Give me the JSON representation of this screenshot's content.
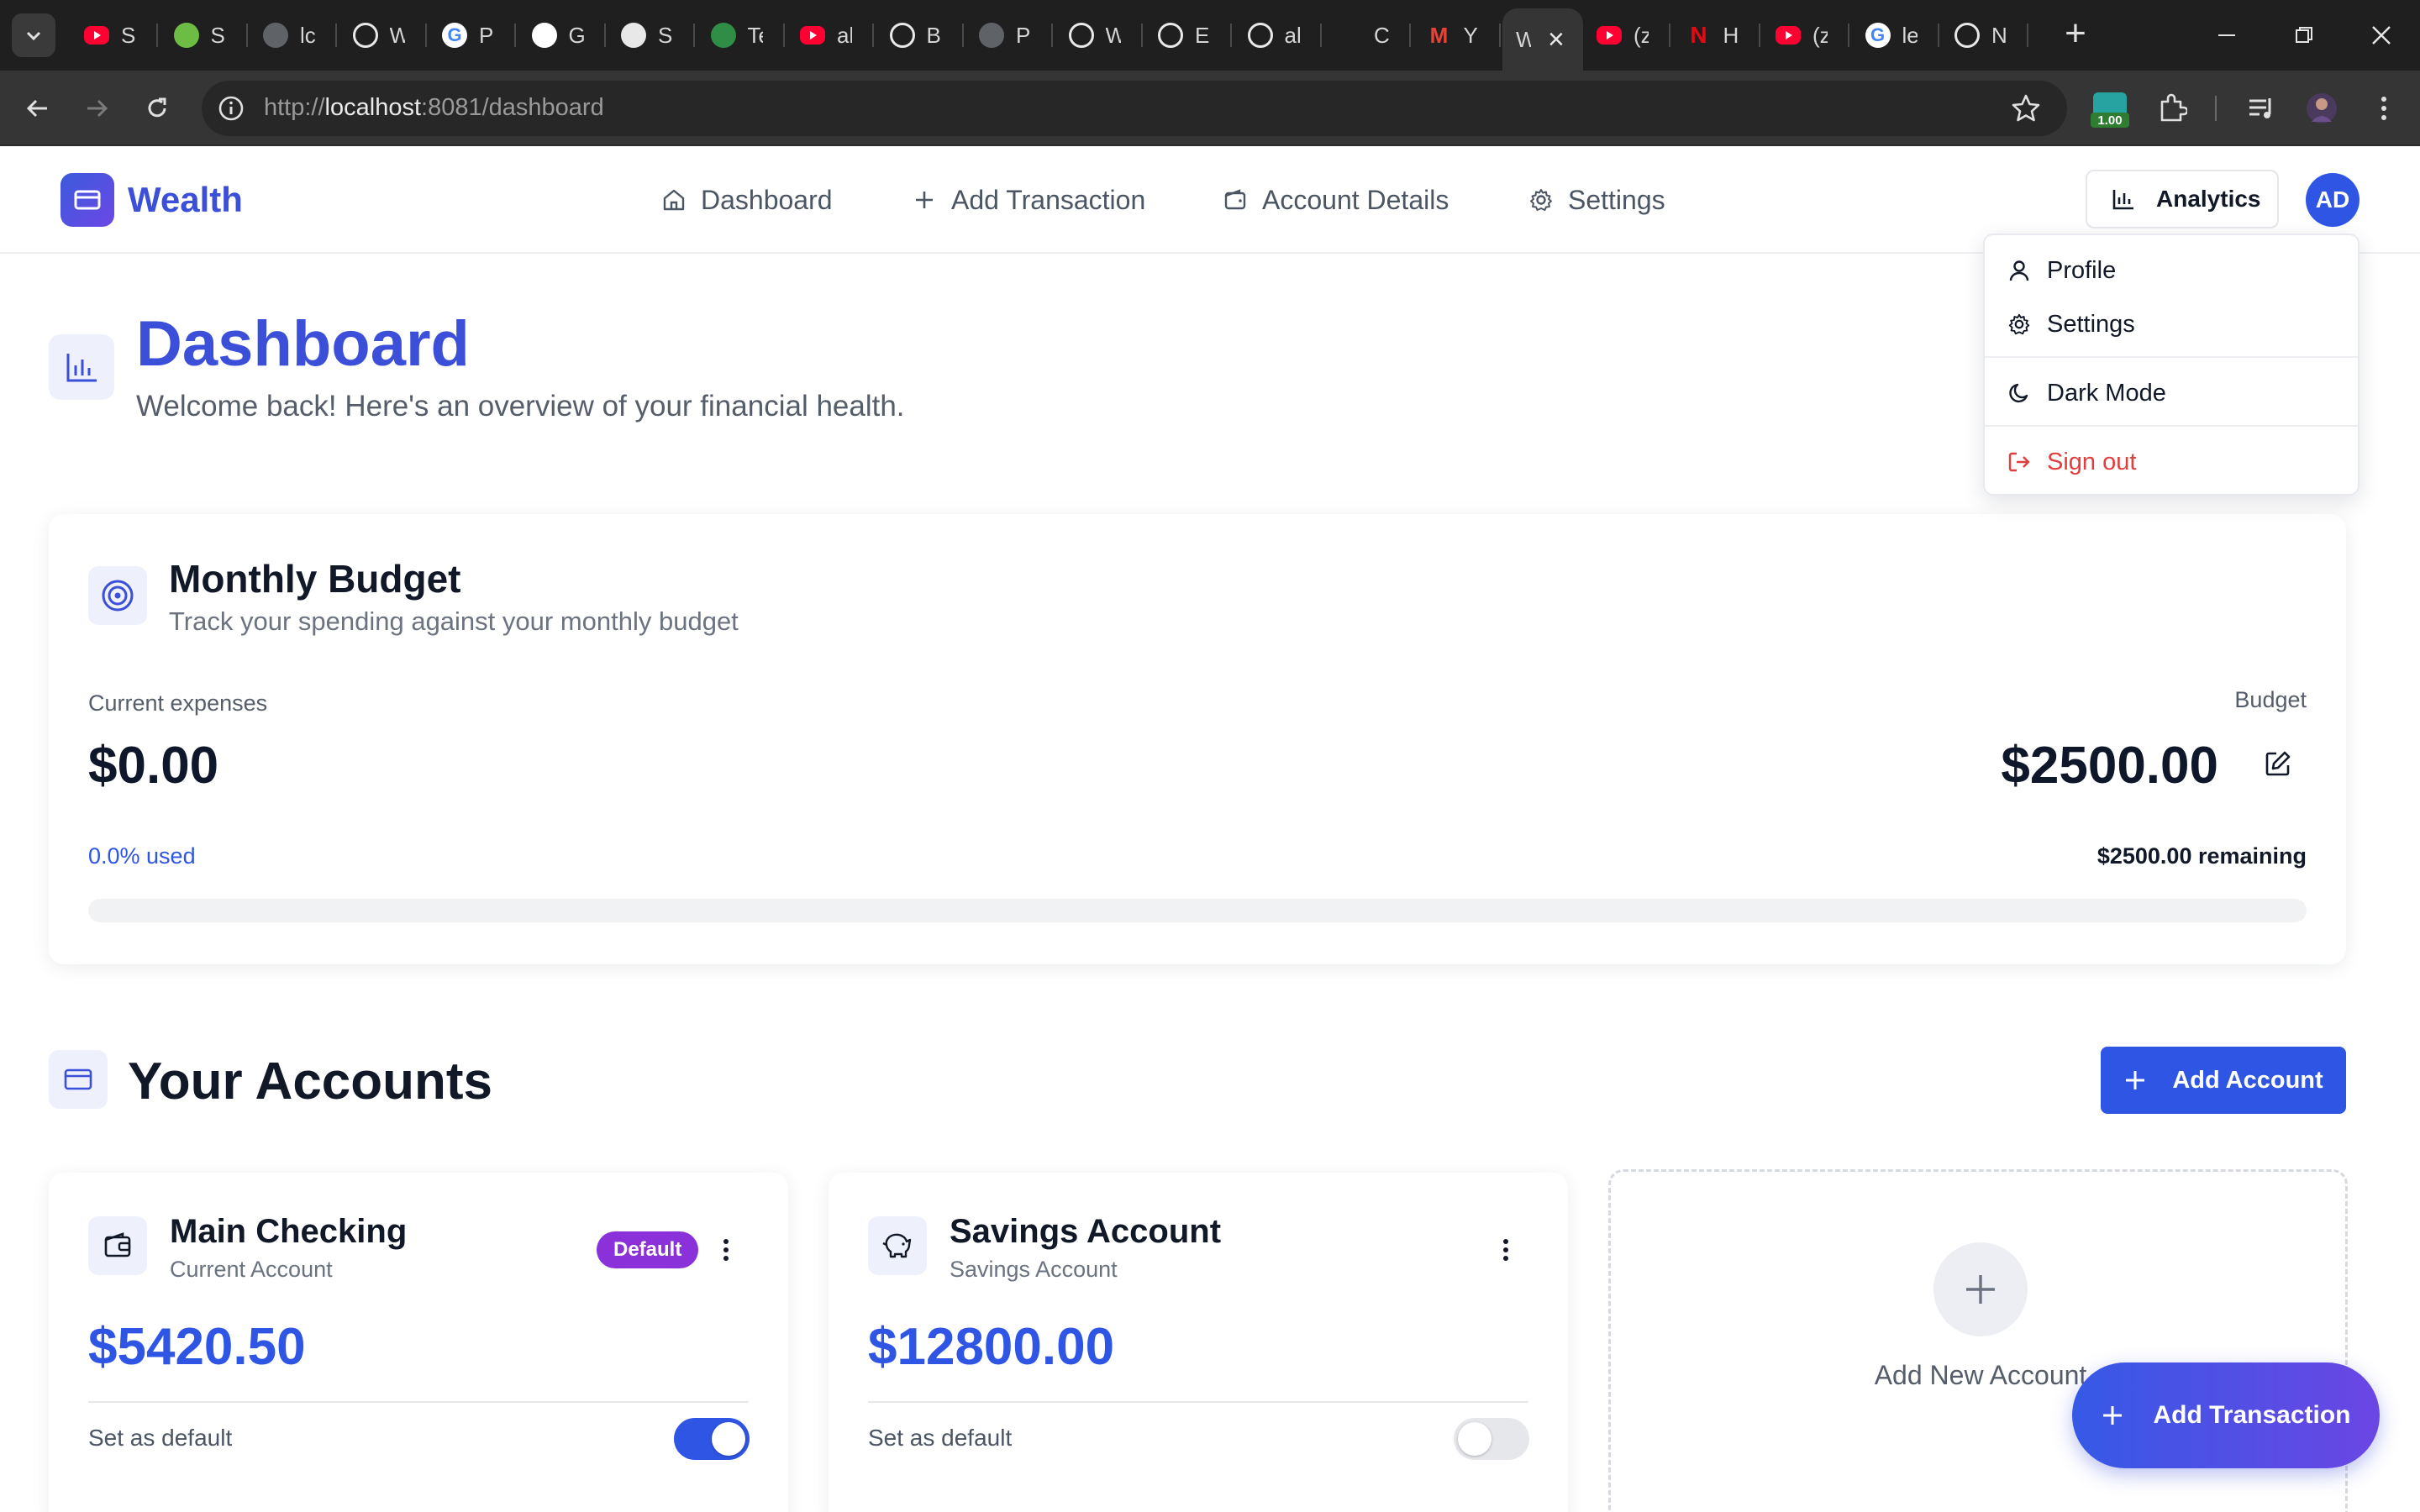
{
  "browser": {
    "tabs": [
      {
        "title": "Si",
        "icon": "youtube-icon",
        "color": "#ff0033"
      },
      {
        "title": "S|",
        "icon": "leaf-icon",
        "color": "#6dbd45"
      },
      {
        "title": "lc",
        "icon": "globe-icon",
        "color": "#5f6368"
      },
      {
        "title": "W",
        "icon": "openai-icon",
        "color": "#1f1f1f"
      },
      {
        "title": "P",
        "icon": "google-icon",
        "color": "#ffffff"
      },
      {
        "title": "G",
        "icon": "tcs-icon",
        "color": "#ffffff"
      },
      {
        "title": "S",
        "icon": "college-icon",
        "color": "#e8e8e8"
      },
      {
        "title": "Te",
        "icon": "gfg-icon",
        "color": "#2f8d46"
      },
      {
        "title": "al",
        "icon": "youtube-icon",
        "color": "#ff0033"
      },
      {
        "title": "B",
        "icon": "stack-icon",
        "color": "#ffffff"
      },
      {
        "title": "P",
        "icon": "globe-icon",
        "color": "#5f6368"
      },
      {
        "title": "W",
        "icon": "openai-icon",
        "color": "#1f1f1f"
      },
      {
        "title": "E",
        "icon": "github-icon",
        "color": "#ffffff"
      },
      {
        "title": "al",
        "icon": "github-icon",
        "color": "#ffffff"
      },
      {
        "title": "C",
        "icon": "link-icon",
        "color": "#1f1f1f"
      },
      {
        "title": "Y",
        "icon": "gmail-icon",
        "color": "#ea4335"
      },
      {
        "title": "W",
        "icon": "page-icon",
        "color": "#353535",
        "active": true
      },
      {
        "title": "(z",
        "icon": "youtube-icon",
        "color": "#ff0033"
      },
      {
        "title": "H",
        "icon": "netflix-icon",
        "color": "#e50914"
      },
      {
        "title": "(z",
        "icon": "youtube-icon",
        "color": "#ff0033"
      },
      {
        "title": "le",
        "icon": "google-icon",
        "color": "#ffffff"
      },
      {
        "title": "N",
        "icon": "chrome-icon",
        "color": "#ffffff"
      }
    ],
    "url_prefix": "http://",
    "url_host": "localhost",
    "url_rest": ":8081/dashboard",
    "extension_badge": "1.00"
  },
  "header": {
    "brand": "Wealth",
    "nav": [
      {
        "label": "Dashboard",
        "icon": "home-icon"
      },
      {
        "label": "Add Transaction",
        "icon": "plus-icon"
      },
      {
        "label": "Account Details",
        "icon": "wallet-icon"
      },
      {
        "label": "Settings",
        "icon": "gear-icon"
      }
    ],
    "analytics_label": "Analytics",
    "avatar_initials": "AD"
  },
  "page": {
    "title": "Dashboard",
    "subtitle": "Welcome back! Here's an overview of your financial health."
  },
  "budget": {
    "title": "Monthly Budget",
    "subtitle": "Track your spending against your monthly budget",
    "expenses_label": "Current expenses",
    "expenses_value": "$0.00",
    "budget_label": "Budget",
    "budget_value": "$2500.00",
    "used_text": "0.0% used",
    "remaining_text": "$2500.00 remaining",
    "used_fraction": 0.0
  },
  "accounts": {
    "title": "Your Accounts",
    "add_button": "Add Account",
    "items": [
      {
        "name": "Main Checking",
        "type": "Current Account",
        "balance": "$5420.50",
        "badge": "Default",
        "default_label": "Set as default",
        "is_default": true
      },
      {
        "name": "Savings Account",
        "type": "Savings Account",
        "balance": "$12800.00",
        "default_label": "Set as default",
        "is_default": false
      }
    ],
    "add_new_label": "Add New Account"
  },
  "fab_label": "Add Transaction",
  "user_menu": {
    "profile": "Profile",
    "settings": "Settings",
    "dark_mode": "Dark Mode",
    "sign_out": "Sign out"
  },
  "colors": {
    "accent": "#2f55e4",
    "brand_text": "#3b4fd8",
    "badge": "#8b31d9",
    "danger": "#e23e3e"
  }
}
